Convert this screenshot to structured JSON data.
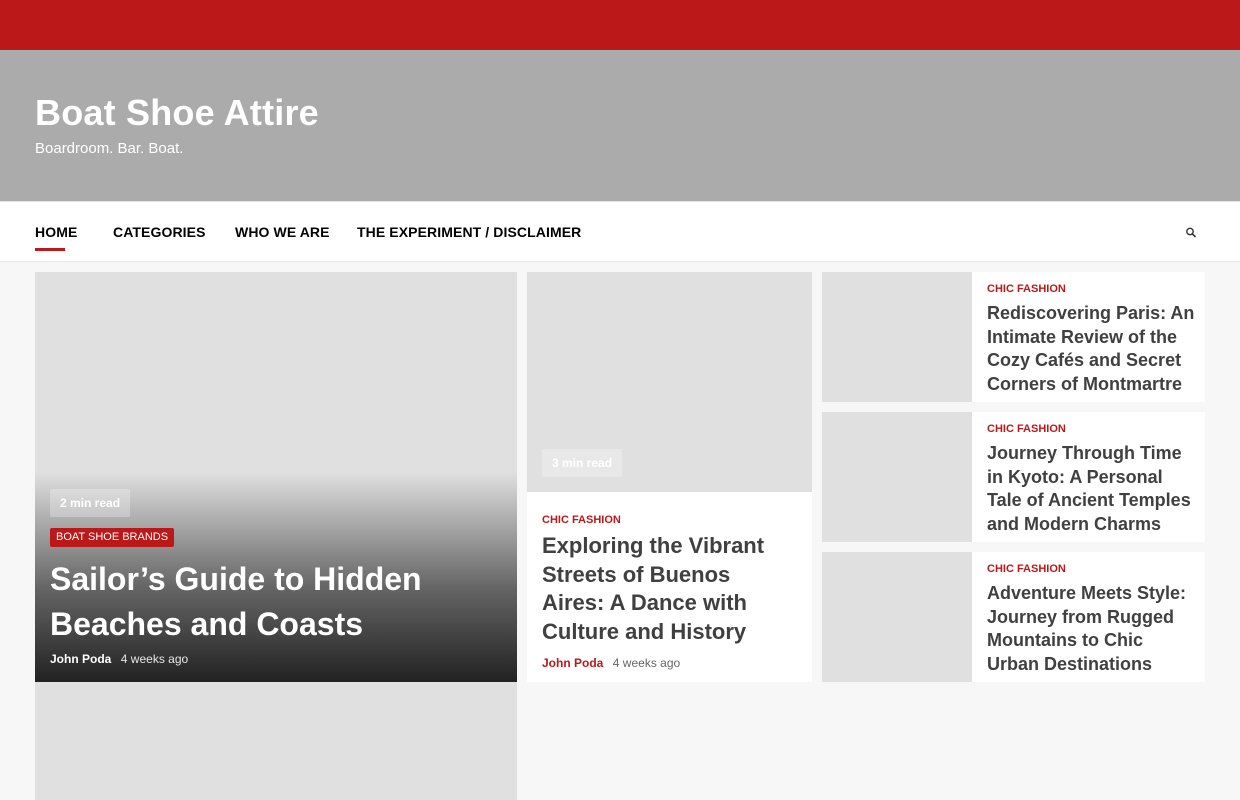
{
  "site": {
    "title": "Boat Shoe Attire",
    "tagline": "Boardroom. Bar. Boat."
  },
  "nav": {
    "items": [
      {
        "label": "HOME",
        "active": true
      },
      {
        "label": "CATEGORIES"
      },
      {
        "label": "WHO WE ARE"
      },
      {
        "label": "THE EXPERIMENT / DISCLAIMER"
      }
    ],
    "search_icon": "search-icon"
  },
  "featured": {
    "read_time": "2 min read",
    "category": "BOAT SHOE BRANDS",
    "title": "Sailor’s Guide to Hidden Beaches and Coasts",
    "author": "John Poda",
    "time": "4 weeks ago"
  },
  "middle": {
    "read_time": "3 min read",
    "category": "CHIC FASHION",
    "title": "Exploring the Vibrant Streets of Buenos Aires: A Dance with Culture and History",
    "author": "John Poda",
    "time": "4 weeks ago"
  },
  "side_list": [
    {
      "category": "CHIC FASHION",
      "title": "Rediscovering Paris: An Intimate Review of the Cozy Cafés and Secret Corners of Montmartre"
    },
    {
      "category": "CHIC FASHION",
      "title": "Journey Through Time in Kyoto: A Personal Tale of Ancient Temples and Modern Charms"
    },
    {
      "category": "CHIC FASHION",
      "title": "Adventure Meets Style: Journey from Rugged Mountains to Chic Urban Destinations"
    }
  ],
  "colors": {
    "accent": "#bb1919",
    "header_bg": "#ababab",
    "placeholder": "#e0e0e0"
  }
}
